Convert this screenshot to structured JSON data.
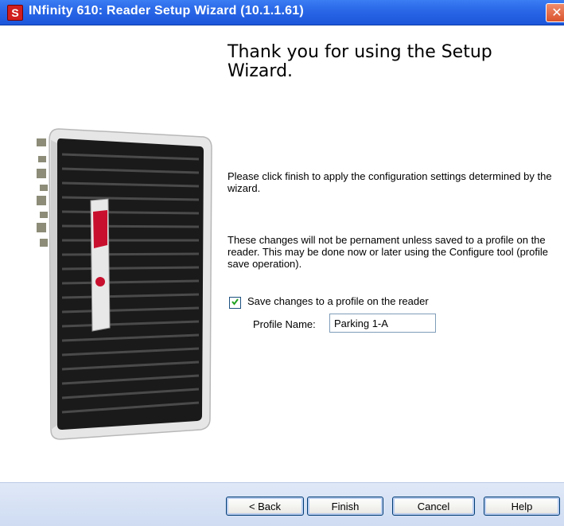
{
  "window": {
    "title": "INfinity 610: Reader Setup Wizard (10.1.1.61)",
    "icon": "app-logo-icon",
    "close_glyph": "✕"
  },
  "main": {
    "heading": "Thank you for using the Setup Wizard.",
    "paragraph1": "Please click finish to apply the configuration settings determined by the wizard.",
    "paragraph2": "These changes will not be pernament unless saved to a profile on the reader.  This may be done now or later using the Configure tool (profile save operation).",
    "save_checkbox": {
      "label": "Save changes to a profile on the reader",
      "checked": true
    },
    "profile": {
      "label": "Profile Name:",
      "value": "Parking 1-A"
    }
  },
  "buttons": {
    "back": "< Back",
    "finish": "Finish",
    "cancel": "Cancel",
    "help": "Help"
  },
  "colors": {
    "titlebar": "#2a68e8",
    "close": "#d9532c",
    "bottombar": "#d8e3f5",
    "button_border": "#003c74",
    "device_body": "#1a1a1a",
    "device_frame": "#e6e6e6",
    "brand_red": "#c8102e"
  }
}
